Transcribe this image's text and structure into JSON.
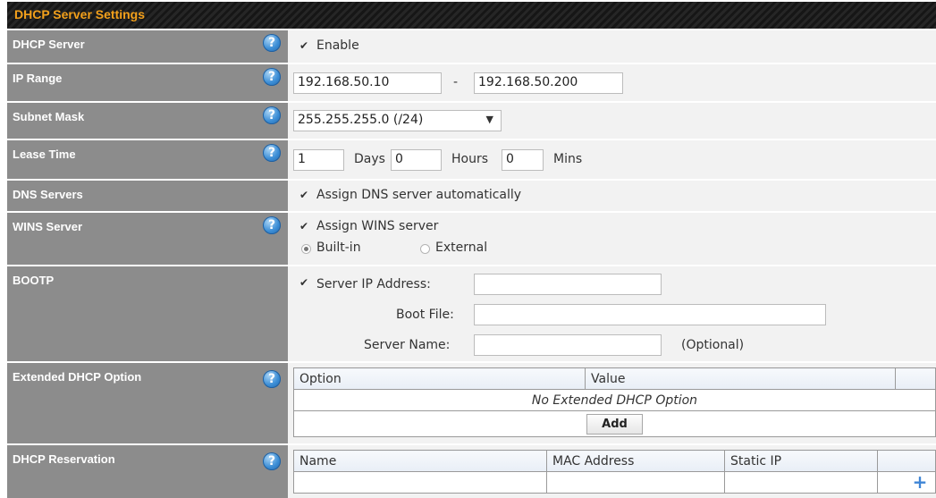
{
  "title": "DHCP Server Settings",
  "rows": {
    "dhcp_server": {
      "label": "DHCP Server",
      "enable_label": "Enable"
    },
    "ip_range": {
      "label": "IP Range",
      "start": "192.168.50.10",
      "separator": "-",
      "end": "192.168.50.200"
    },
    "subnet_mask": {
      "label": "Subnet Mask",
      "selected": "255.255.255.0 (/24)"
    },
    "lease_time": {
      "label": "Lease Time",
      "days": "1",
      "days_label": "Days",
      "hours": "0",
      "hours_label": "Hours",
      "mins": "0",
      "mins_label": "Mins"
    },
    "dns_servers": {
      "label": "DNS Servers",
      "auto_label": "Assign DNS server automatically"
    },
    "wins_server": {
      "label": "WINS Server",
      "assign_label": "Assign WINS server",
      "builtin_label": "Built-in",
      "external_label": "External"
    },
    "bootp": {
      "label": "BOOTP",
      "server_ip_label": "Server IP Address:",
      "boot_file_label": "Boot File:",
      "server_name_label": "Server Name:",
      "optional_label": "(Optional)"
    },
    "extended_dhcp": {
      "label": "Extended DHCP Option",
      "col_option": "Option",
      "col_value": "Value",
      "empty": "No Extended DHCP Option",
      "add_label": "Add"
    },
    "dhcp_reservation": {
      "label": "DHCP Reservation",
      "col_name": "Name",
      "col_mac": "MAC Address",
      "col_ip": "Static IP",
      "add_icon": "plus-icon"
    }
  },
  "help_glyph": "?",
  "check_glyph": "✔",
  "colors": {
    "title_text": "#f3a01b",
    "label_bg": "#8c8c8c",
    "help_icon": "#3c8ed6",
    "plus": "#3f85d6"
  }
}
